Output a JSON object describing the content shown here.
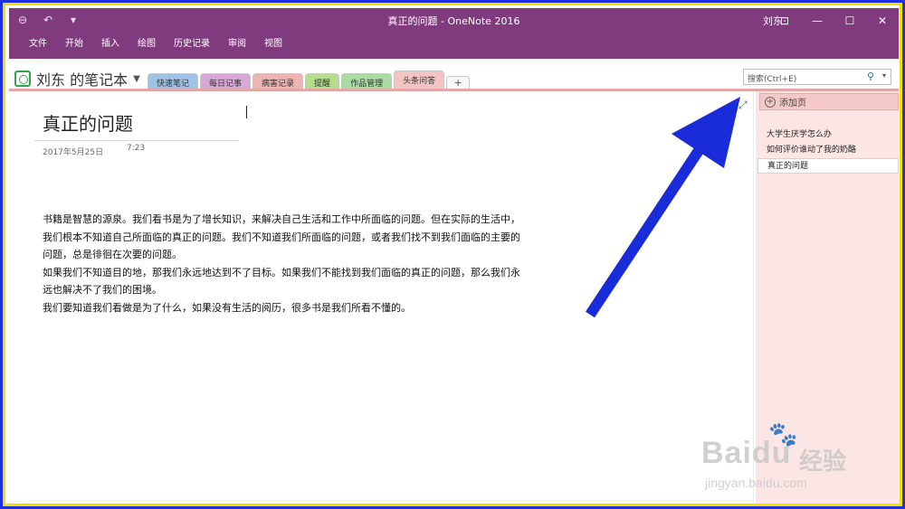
{
  "window": {
    "title": "真正的问题 - OneNote 2016",
    "user": "刘东"
  },
  "ribbon": {
    "tabs": [
      "文件",
      "开始",
      "插入",
      "绘图",
      "历史记录",
      "审阅",
      "视图"
    ]
  },
  "notebook": {
    "name": "刘东 的笔记本",
    "sections": [
      {
        "label": "快速笔记",
        "color": "#9ec3e6"
      },
      {
        "label": "每日记事",
        "color": "#d7a7d7"
      },
      {
        "label": "病害记录",
        "color": "#f0b3b3"
      },
      {
        "label": "提醒",
        "color": "#b5dd8c"
      },
      {
        "label": "作品管理",
        "color": "#a9dba3"
      },
      {
        "label": "头条问答",
        "color": "#f4c3c3"
      }
    ],
    "add_section": "+"
  },
  "search": {
    "placeholder": "搜索(Ctrl+E)"
  },
  "page": {
    "title": "真正的问题",
    "date": "2017年5月25日",
    "time": "7:23",
    "paragraphs": [
      "书籍是智慧的源泉。我们看书是为了增长知识，来解决自己生活和工作中所面临的问题。但在实际的生活中，我们根本不知道自己所面临的真正的问题。我们不知道我们所面临的问题，或者我们找不到我们面临的主要的问题，总是徘徊在次要的问题。",
      "如果我们不知道目的地，那我们永远地达到不了目标。如果我们不能找到我们面临的真正的问题，那么我们永远也解决不了我们的困境。",
      "我们要知道我们看做是为了什么，如果没有生活的阅历，很多书是我们所看不懂的。"
    ]
  },
  "pages_pane": {
    "add_page": "添加页",
    "pages": [
      "大学生厌学怎么办",
      "如何评价谁动了我的奶酪",
      "真正的问题"
    ]
  },
  "watermark": {
    "brand": "Baidu",
    "cn": "经验",
    "url": "jingyan.baidu.com"
  },
  "colors": {
    "titlebar": "#803b7e",
    "frame": "#1e2fe0",
    "frame_border": "#f4e000",
    "arrow": "#1a2bd9"
  }
}
